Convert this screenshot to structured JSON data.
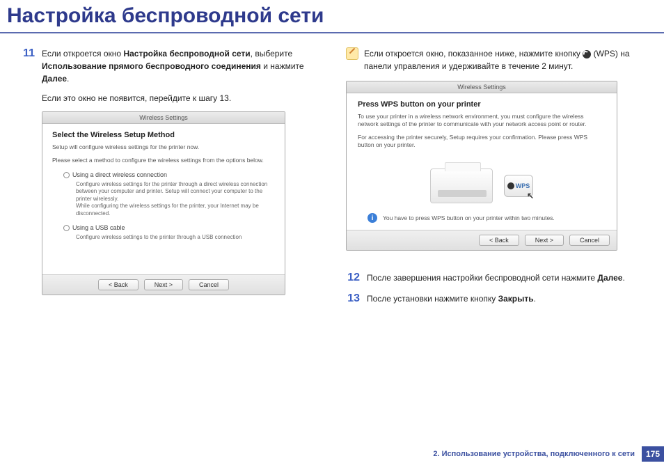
{
  "title": "Настройка беспроводной сети",
  "left": {
    "step11_num": "11",
    "step11_1": "Если откроется окно ",
    "step11_b1": "Настройка беспроводной сети",
    "step11_2": ", выберите ",
    "step11_b2": "Использование прямого беспроводного соединения",
    "step11_3": " и нажмите ",
    "step11_b3": "Далее",
    "step11_4": ".",
    "followup": "Если это окно не появится, перейдите к шагу 13.",
    "ss": {
      "title": "Wireless Settings",
      "heading": "Select the Wireless Setup Method",
      "sub1": "Setup will configure wireless settings for the printer now.",
      "sub2": "Please select a method to configure the wireless settings from the options below.",
      "opt1": "Using a direct wireless connection",
      "opt1_desc": "Configure wireless settings for the printer through a direct wireless connection between your computer and printer. Setup will connect your computer to the printer wirelessly.\nWhile configuring the wireless settings for the printer, your Internet may be disconnected.",
      "opt2": "Using a USB cable",
      "opt2_desc": "Configure wireless settings to the printer through a USB connection",
      "back": "< Back",
      "next": "Next >",
      "cancel": "Cancel"
    }
  },
  "right": {
    "note_1": "Если откроется окно, показанное ниже, нажмите кнопку ",
    "note_2": " (WPS) на панели управления и удерживайте в течение 2 минут.",
    "ss": {
      "title": "Wireless Settings",
      "heading": "Press WPS button on your printer",
      "p1": "To use your printer in a wireless network environment, you must configure the wireless network settings of the printer to communicate with your network access point or router.",
      "p2": "For accessing the printer securely, Setup requires your confirmation. Please press WPS button on your printer.",
      "wps_label": "WPS",
      "info": "You have to press WPS button on your printer within two minutes.",
      "back": "< Back",
      "next": "Next >",
      "cancel": "Cancel"
    },
    "step12_num": "12",
    "step12_1": "После завершения настройки беспроводной сети нажмите ",
    "step12_b": "Далее",
    "step12_2": ".",
    "step13_num": "13",
    "step13_1": "После установки нажмите кнопку ",
    "step13_b": "Закрыть",
    "step13_2": "."
  },
  "footer": {
    "text": "2.  Использование устройства, подключенного к сети",
    "page": "175"
  }
}
